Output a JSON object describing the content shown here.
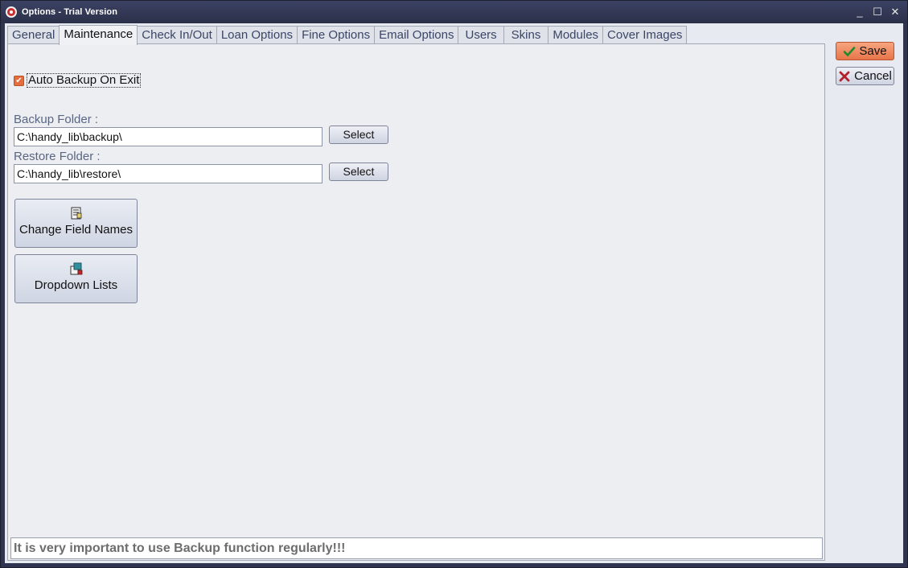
{
  "window": {
    "title": "Options - Trial Version",
    "icon": "app-logo-icon",
    "controls": {
      "minimize": "_",
      "maximize": "☐",
      "close": "✕"
    }
  },
  "tabs": [
    {
      "label": "General",
      "active": false
    },
    {
      "label": "Maintenance",
      "active": true
    },
    {
      "label": "Check In/Out",
      "active": false
    },
    {
      "label": "Loan Options",
      "active": false
    },
    {
      "label": "Fine Options",
      "active": false
    },
    {
      "label": "Email Options",
      "active": false
    },
    {
      "label": "Users",
      "active": false
    },
    {
      "label": "Skins",
      "active": false
    },
    {
      "label": "Modules",
      "active": false
    },
    {
      "label": "Cover Images",
      "active": false
    }
  ],
  "maintenance": {
    "auto_backup": {
      "label": "Auto Backup On Exit",
      "checked": true,
      "check_glyph": "✔"
    },
    "backup_folder": {
      "label": "Backup Folder :",
      "value": "C:\\handy_lib\\backup\\",
      "button": "Select"
    },
    "restore_folder": {
      "label": "Restore Folder :",
      "value": "C:\\handy_lib\\restore\\",
      "button": "Select"
    },
    "change_field_names": {
      "label": "Change Field Names",
      "icon": "document-edit-icon"
    },
    "dropdown_lists": {
      "label": "Dropdown Lists",
      "icon": "list-arrow-icon"
    },
    "status_message": "It is very important to use Backup function regularly!!!"
  },
  "actions": {
    "save": {
      "label": "Save",
      "icon": "checkmark-icon"
    },
    "cancel": {
      "label": "Cancel",
      "icon": "x-mark-icon"
    }
  },
  "colors": {
    "accent": "#e8754a",
    "panel": "#eceef2",
    "title_bar": "#2f3550",
    "status_text": "#6d6d6d"
  }
}
